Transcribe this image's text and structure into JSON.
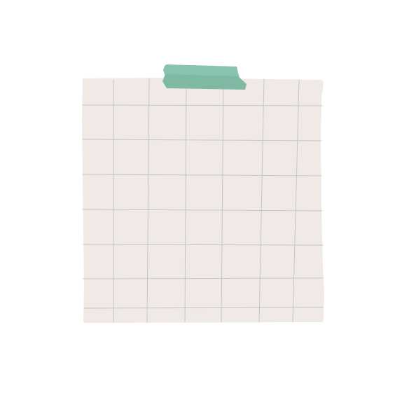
{
  "note": {
    "paper_color": "#f1e9e6",
    "grid_line_color": "#bccbc8",
    "grid_columns": 7,
    "grid_rows": 7,
    "tape_color": "#8ac3ad",
    "tape_overlap_color": "#7fb8a3"
  },
  "icons": {
    "note": "grid-paper-note-icon",
    "tape": "washi-tape-icon"
  }
}
